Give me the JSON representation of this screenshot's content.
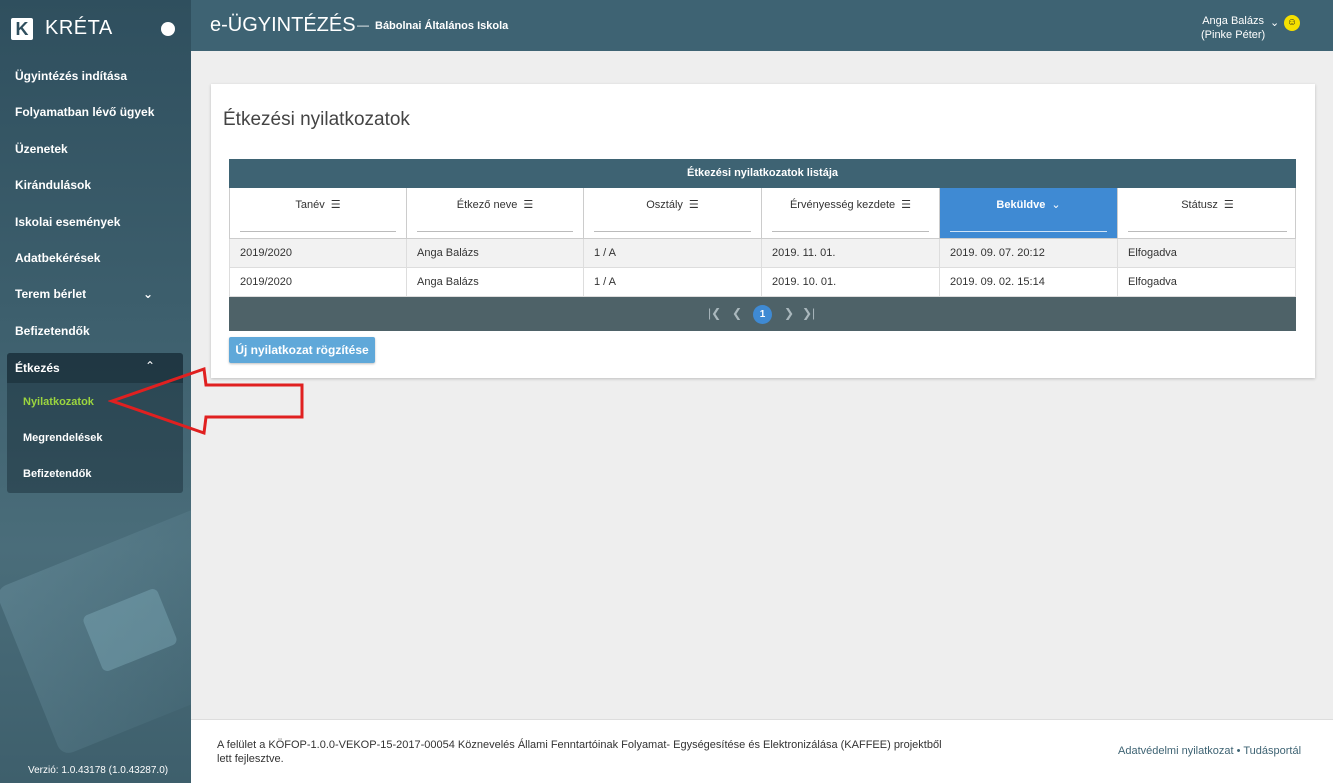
{
  "sidebar": {
    "brand": {
      "logo_letter": "K",
      "name": "KRÉTA"
    },
    "items": [
      {
        "label": "Ügyintézés indítása"
      },
      {
        "label": "Folyamatban lévő ügyek"
      },
      {
        "label": "Üzenetek"
      },
      {
        "label": "Kirándulások"
      },
      {
        "label": "Iskolai események"
      },
      {
        "label": "Adatbekérések"
      },
      {
        "label": "Terem bérlet",
        "chevron": "chevron-down-icon"
      },
      {
        "label": "Befizetendők"
      }
    ],
    "expanded": {
      "label": "Étkezés",
      "chevron": "chevron-up-icon",
      "children": [
        {
          "label": "Nyilatkozatok",
          "active": true
        },
        {
          "label": "Megrendelések"
        },
        {
          "label": "Befizetendők"
        }
      ]
    },
    "version": "Verzió: 1.0.43178 (1.0.43287.0)"
  },
  "header": {
    "app_title": "e-ÜGYINTÉZÉS",
    "separator": "—",
    "school": "Bábolnai Általános Iskola",
    "user_name": "Anga Balázs",
    "user_sub": "(Pinke Péter)",
    "user_icon": "accessibility-icon"
  },
  "main": {
    "title": "Étkezési nyilatkozatok",
    "grid": {
      "caption": "Étkezési nyilatkozatok listája",
      "columns": [
        {
          "label": "Tanév"
        },
        {
          "label": "Étkező neve"
        },
        {
          "label": "Osztály"
        },
        {
          "label": "Érvényesség kezdete"
        },
        {
          "label": "Beküldve",
          "sorted": "desc"
        },
        {
          "label": "Státusz"
        }
      ],
      "rows": [
        [
          "2019/2020",
          "Anga Balázs",
          "1 / A",
          "2019. 11. 01.",
          "2019. 09. 07. 20:12",
          "Elfogadva"
        ],
        [
          "2019/2020",
          "Anga Balázs",
          "1 / A",
          "2019. 10. 01.",
          "2019. 09. 02. 15:14",
          "Elfogadva"
        ]
      ],
      "pager": {
        "current_page": "1"
      }
    },
    "add_button": "Új nyilatkozat rögzítése"
  },
  "footer": {
    "text": "A felület a KÖFOP-1.0.0-VEKOP-15-2017-00054 Köznevelés Állami Fenntartóinak Folyamat- Egységesítése és Elektronizálása (KAFFEE) projektből lett fejlesztve.",
    "link_privacy": "Adatvédelmi nyilatkozat",
    "link_sep": "•",
    "link_portal": "Tudásportál"
  },
  "colors": {
    "header_bg": "#3e6373",
    "sorted_col": "#3f8ad3",
    "active_menu": "#9bd53f",
    "annotation_arrow": "#e02020"
  }
}
